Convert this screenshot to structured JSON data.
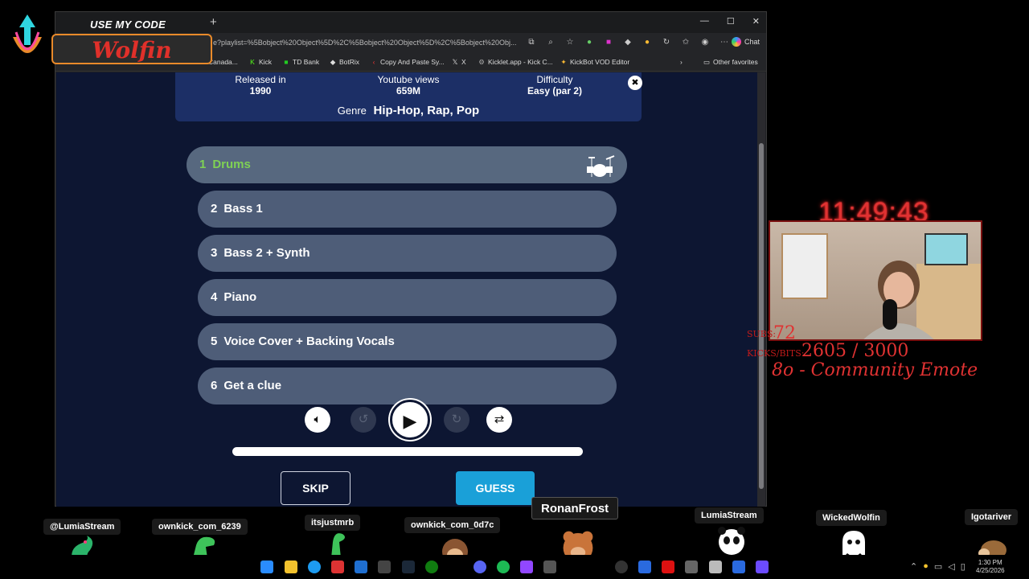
{
  "browser": {
    "url": "e?playlist=%5Bobject%20Object%5D%2C%5Bobject%20Object%5D%2C%5Bobject%20Obj...",
    "chat_label": "Chat",
    "bookmarks": [
      "Canada...",
      "Kick",
      "TD Bank",
      "BotRix",
      "Copy And Paste Sy...",
      "X",
      "Kicklet.app - Kick C...",
      "KickBot VOD Editor"
    ],
    "other_favorites": "Other favorites"
  },
  "song_info": {
    "released_label": "Released in",
    "released_value": "1990",
    "views_label": "Youtube views",
    "views_value": "659M",
    "difficulty_label": "Difficulty",
    "difficulty_value": "Easy (par 2)",
    "genre_label": "Genre",
    "genre_value": "Hip-Hop, Rap, Pop"
  },
  "tracks": [
    {
      "num": "1",
      "label": "Drums"
    },
    {
      "num": "2",
      "label": "Bass 1"
    },
    {
      "num": "3",
      "label": "Bass 2 + Synth"
    },
    {
      "num": "4",
      "label": "Piano"
    },
    {
      "num": "5",
      "label": "Voice Cover + Backing Vocals"
    },
    {
      "num": "6",
      "label": "Get a clue"
    }
  ],
  "controls": {
    "volume_icon": "speaker-icon",
    "rewind_icon": "rewind-5-icon",
    "play_icon": "play-icon",
    "forward_icon": "forward-5-icon",
    "loop_icon": "repeat-off-icon",
    "progress": 1.0
  },
  "actions": {
    "skip_label": "SKIP",
    "guess_label": "GUESS"
  },
  "promo": {
    "line1": "USE MY CODE",
    "code": "Wolfin"
  },
  "stream": {
    "clock": "11:49:43",
    "subs_label": "SUBS:",
    "subs_value": "72",
    "kicks_label": "KICKS/BITS:",
    "kicks_value": "2605 / 3000",
    "goal_text": "8o - Community Emote"
  },
  "tooltip": "RonanFrost",
  "chatters": [
    "@LumiaStream",
    "ownkick_com_6239",
    "itsjustmrb",
    "ownkick_com_0d7c",
    "LumiaStream",
    "WickedWolfin",
    "Igotariver"
  ],
  "taskbar": {
    "time": "1:30 PM",
    "date": "4/25/2026"
  },
  "colors": {
    "page_bg": "#0d1632",
    "track_bg": "#4e5d78",
    "active_track_text": "#7fd154",
    "guess_bg": "#1aa0d8",
    "promo_accent": "#e0302a",
    "overlay_red": "#e03232"
  }
}
